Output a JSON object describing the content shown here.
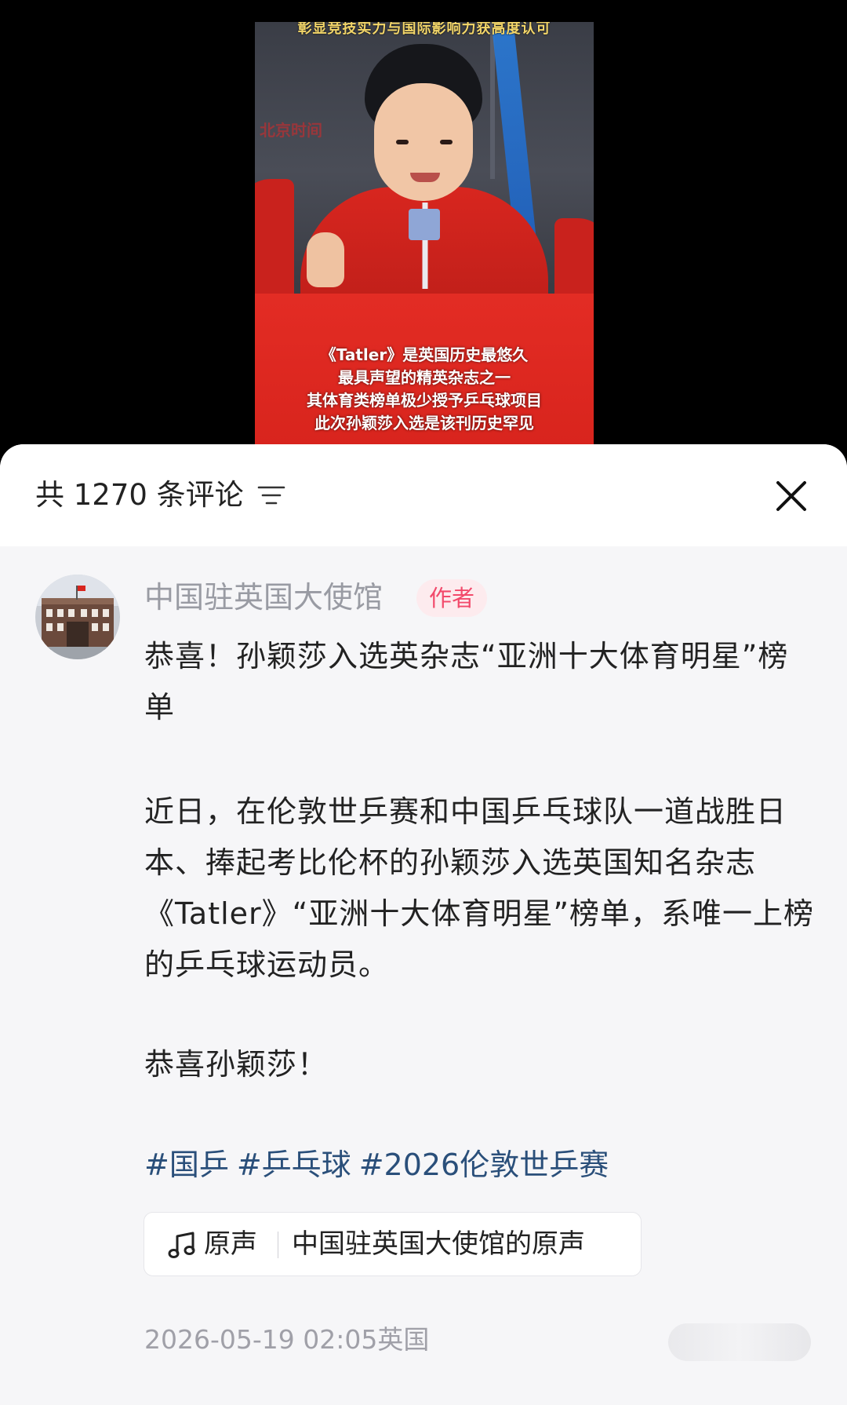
{
  "video": {
    "top_caption": "彰显竞技实力与国际影响力获高度认可",
    "watermark": "北京时间",
    "overlay_lines": [
      "《Tatler》是英国历史最悠久",
      "最具声望的精英杂志之一",
      "其体育类榜单极少授予乒乓球项目",
      "此次孙颖莎入选是该刊历史罕见"
    ]
  },
  "sheet": {
    "comment_count_label": "共 1270 条评论",
    "sort_icon": "sort-lines-icon",
    "close_icon": "close-icon"
  },
  "comment": {
    "author": "中国驻英国大使馆",
    "author_badge": "作者",
    "paragraphs": [
      "恭喜！孙颖莎入选英杂志“亚洲十大体育明星”榜单",
      "近日，在伦敦世乒赛和中国乒乓球队一道战胜日本、捧起考比伦杯的孙颖莎入选英国知名杂志《Tatler》“亚洲十大体育明星”榜单，系唯一上榜的乒乓球运动员。",
      "恭喜孙颖莎！"
    ],
    "hashtags": [
      "#国乒",
      "#乒乓球",
      "#2026伦敦世乒赛"
    ],
    "sound": {
      "icon": "music-note-icon",
      "label": "原声",
      "title": "中国驻英国大使馆的原声"
    },
    "timestamp": "2026-05-19 02:05英国"
  },
  "colors": {
    "accent_red": "#e32c24",
    "badge_pink": "#f24a6b",
    "hashtag_blue": "#2a4f7a",
    "sheet_bg": "#f6f6f8"
  }
}
